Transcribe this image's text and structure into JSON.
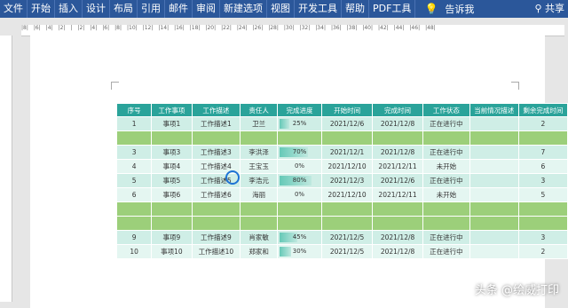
{
  "ribbon": {
    "tabs": [
      "文件",
      "开始",
      "插入",
      "设计",
      "布局",
      "引用",
      "邮件",
      "审阅",
      "新建选项",
      "视图",
      "开发工具",
      "帮助",
      "PDF工具"
    ],
    "tell_me": "告诉我",
    "share": "共享"
  },
  "ruler_marks": [
    "|8|",
    "|6|",
    "|4|",
    "|2|",
    "|",
    "|2|",
    "|4|",
    "|6|",
    "|8|",
    "|10|",
    "|12|",
    "|14|",
    "|16|",
    "|18|",
    "|20|",
    "|22|",
    "|24|",
    "|26|",
    "|28|",
    "|30|",
    "|32|",
    "|34|",
    "|36|",
    "|38|",
    "|40|",
    "|42|",
    "|44|",
    "|46|",
    "|48|"
  ],
  "table": {
    "headers": [
      "序号",
      "工作事项",
      "工作描述",
      "责任人",
      "完成进度",
      "开始时间",
      "完成时间",
      "工作状态",
      "当前情况描述",
      "剩余完成时间"
    ],
    "rows": [
      {
        "style": "l",
        "cells": [
          "1",
          "事项1",
          "工作描述1",
          "卫兰",
          "",
          "2021/12/6",
          "2021/12/8",
          "正在进行中",
          "",
          "2"
        ],
        "progress": "25%",
        "pct": 0.25
      },
      {
        "style": "g",
        "cells": [
          "",
          "",
          "",
          "",
          "",
          "",
          "",
          "",
          "",
          ""
        ],
        "progress": "",
        "pct": 0
      },
      {
        "style": "l",
        "cells": [
          "3",
          "事项3",
          "工作描述3",
          "李洪泽",
          "",
          "2021/12/1",
          "2021/12/8",
          "正在进行中",
          "",
          "7"
        ],
        "progress": "70%",
        "pct": 0.7
      },
      {
        "style": "w",
        "cells": [
          "4",
          "事项4",
          "工作描述4",
          "王宝玉",
          "",
          "2021/12/10",
          "2021/12/11",
          "未开始",
          "",
          "6"
        ],
        "progress": "0%",
        "pct": 0
      },
      {
        "style": "l",
        "cells": [
          "5",
          "事项5",
          "工作描述5",
          "李浩元",
          "",
          "2021/12/3",
          "2021/12/6",
          "正在进行中",
          "",
          "3"
        ],
        "progress": "80%",
        "pct": 0.8
      },
      {
        "style": "w",
        "cells": [
          "6",
          "事项6",
          "工作描述6",
          "海丽",
          "",
          "2021/12/10",
          "2021/12/11",
          "未开始",
          "",
          "5"
        ],
        "progress": "0%",
        "pct": 0
      },
      {
        "style": "g",
        "cells": [
          "",
          "",
          "",
          "",
          "",
          "",
          "",
          "",
          "",
          ""
        ],
        "progress": "",
        "pct": 0
      },
      {
        "style": "g",
        "cells": [
          "",
          "",
          "",
          "",
          "",
          "",
          "",
          "",
          "",
          ""
        ],
        "progress": "",
        "pct": 0
      },
      {
        "style": "l",
        "cells": [
          "9",
          "事项9",
          "工作描述9",
          "肖家敏",
          "",
          "2021/12/5",
          "2021/12/8",
          "正在进行中",
          "",
          "3"
        ],
        "progress": "45%",
        "pct": 0.45
      },
      {
        "style": "w",
        "cells": [
          "10",
          "事项10",
          "工作描述10",
          "郑家和",
          "",
          "2021/12/5",
          "2021/12/8",
          "正在进行中",
          "",
          "2"
        ],
        "progress": "30%",
        "pct": 0.3
      }
    ]
  },
  "watermark": "头条 @绘威打印"
}
